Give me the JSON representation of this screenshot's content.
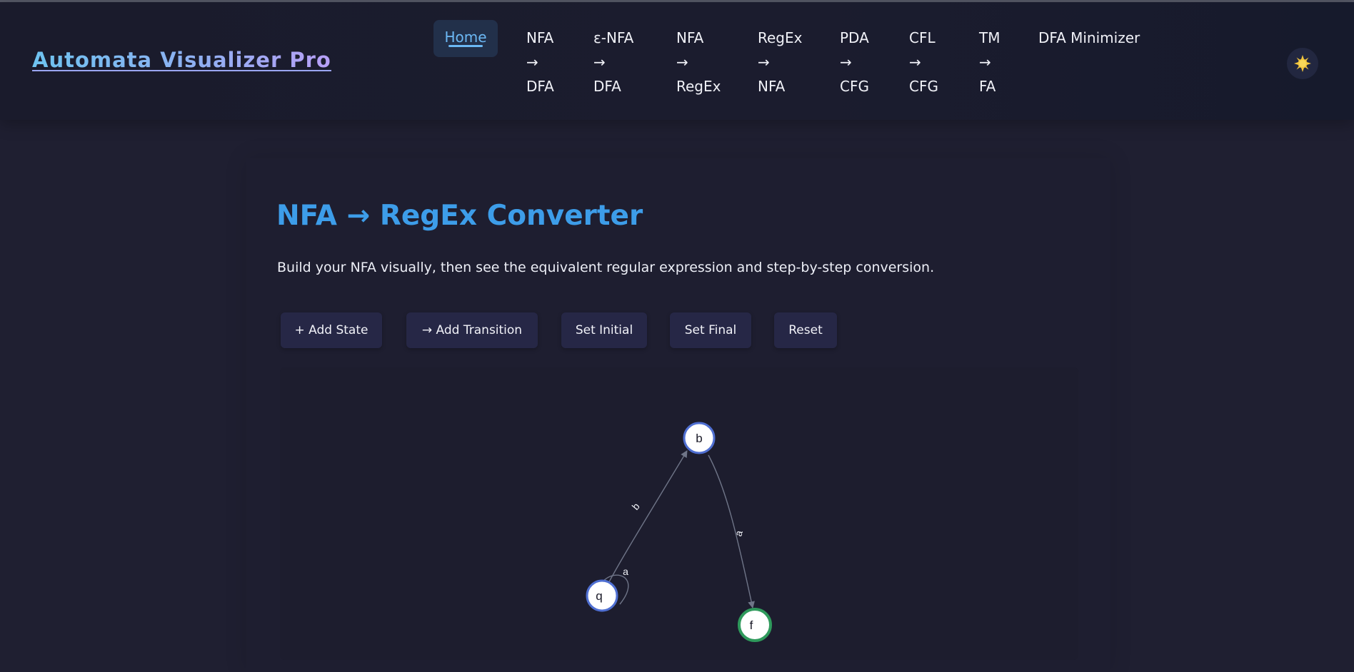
{
  "app": {
    "brand": "Automata Visualizer Pro"
  },
  "nav": {
    "home": "Home",
    "items": [
      {
        "lines": [
          "NFA",
          "→",
          "DFA"
        ]
      },
      {
        "lines": [
          "ε-NFA",
          "→",
          "DFA"
        ]
      },
      {
        "lines": [
          "NFA",
          "→",
          "RegEx"
        ]
      },
      {
        "lines": [
          "RegEx",
          "→",
          "NFA"
        ]
      },
      {
        "lines": [
          "PDA",
          "→",
          "CFG"
        ]
      },
      {
        "lines": [
          "CFL",
          "→",
          "CFG"
        ]
      },
      {
        "lines": [
          "TM",
          "→",
          "FA"
        ]
      },
      {
        "lines": [
          "DFA Minimizer"
        ]
      }
    ],
    "theme_icon": "sun-icon",
    "theme_glyph": "🌞"
  },
  "page": {
    "title": "NFA → RegEx Converter",
    "subtitle": "Build your NFA visually, then see the equivalent regular expression and step-by-step conversion."
  },
  "toolbar": {
    "add_state": "+ Add State",
    "add_transition": "→ Add Transition",
    "set_initial": "Set Initial",
    "set_final": "Set Final",
    "reset": "Reset"
  },
  "graph": {
    "states": [
      {
        "id": "b",
        "label": "b",
        "final": false
      },
      {
        "id": "q",
        "label": "q",
        "final": false
      },
      {
        "id": "f",
        "label": "f",
        "final": true
      }
    ],
    "transitions": [
      {
        "from": "q",
        "to": "b",
        "label": "b"
      },
      {
        "from": "b",
        "to": "f",
        "label": "a"
      },
      {
        "from": "q",
        "to": "q",
        "label": "a"
      }
    ],
    "colors": {
      "normal_border": "#4f6fd2",
      "final_border": "#2f9a5c",
      "edge": "#6f7588"
    }
  }
}
